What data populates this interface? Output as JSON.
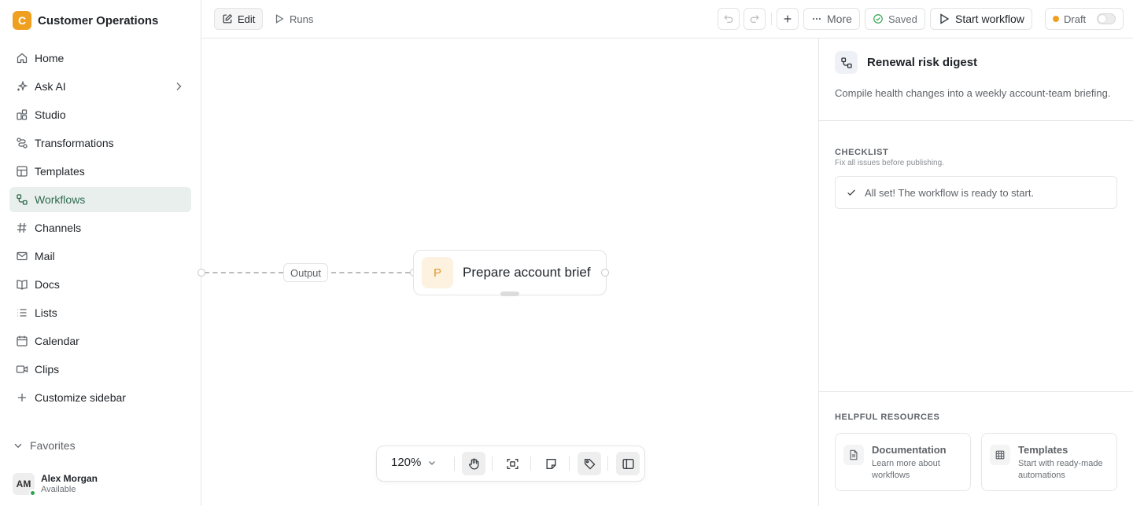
{
  "workspace": {
    "logo_letter": "C",
    "name": "Customer Operations"
  },
  "sidebar": {
    "items": [
      {
        "label": "Home",
        "icon": "home-icon"
      },
      {
        "label": "Ask AI",
        "icon": "sparkles-icon"
      },
      {
        "label": "Studio",
        "icon": "studio-icon"
      },
      {
        "label": "Transformations",
        "icon": "transform-icon"
      },
      {
        "label": "Templates",
        "icon": "template-icon"
      },
      {
        "label": "Workflows",
        "icon": "workflow-icon",
        "active": true
      },
      {
        "label": "Channels",
        "icon": "hash-icon"
      },
      {
        "label": "Mail",
        "icon": "mail-icon"
      },
      {
        "label": "Docs",
        "icon": "book-icon"
      },
      {
        "label": "Lists",
        "icon": "list-icon"
      },
      {
        "label": "Calendar",
        "icon": "calendar-icon"
      },
      {
        "label": "Clips",
        "icon": "video-icon"
      },
      {
        "label": "Customize sidebar",
        "icon": "plus-icon"
      }
    ],
    "favorites_label": "Favorites",
    "user": {
      "initials": "AM",
      "name": "Alex Morgan",
      "status": "Available"
    }
  },
  "toolbar": {
    "edit_label": "Edit",
    "runs_label": "Runs",
    "more_label": "More",
    "saved_label": "Saved",
    "start_label": "Start workflow",
    "draft_label": "Draft"
  },
  "canvas": {
    "edge_label": "Output",
    "node": {
      "badge": "P",
      "title": "Prepare account brief"
    },
    "zoom": "120%"
  },
  "panel": {
    "title": "Renewal risk digest",
    "description": "Compile health changes into a weekly account-team briefing.",
    "checklist": {
      "title": "CHECKLIST",
      "subtitle": "Fix all issues before publishing.",
      "status": "All set! The workflow is ready to start."
    },
    "resources": {
      "title": "HELPFUL RESOURCES",
      "cards": [
        {
          "title": "Documentation",
          "desc": "Learn more about workflows",
          "icon": "document-icon"
        },
        {
          "title": "Templates",
          "desc": "Start with ready-made automations",
          "icon": "grid-icon"
        }
      ]
    }
  },
  "colors": {
    "accent": "#2f6b4f",
    "active_bg": "#e9efec",
    "brand": "#f0a020",
    "success": "#2ea44f"
  }
}
